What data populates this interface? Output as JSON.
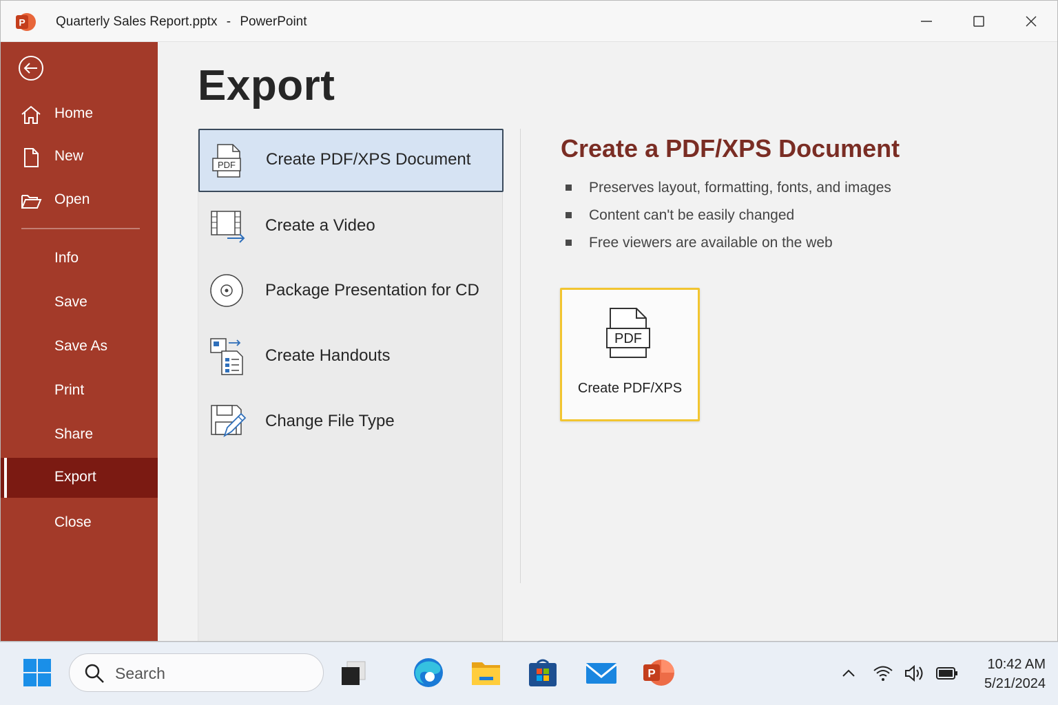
{
  "window": {
    "file_name": "Quarterly Sales Report.pptx",
    "separator": "-",
    "app_name": "PowerPoint",
    "app_logo_letter": "P"
  },
  "sidebar": {
    "back_icon": "arrow-left-circle-icon",
    "items": [
      {
        "label": "Home",
        "icon": "home-icon"
      },
      {
        "label": "New",
        "icon": "new-document-icon"
      },
      {
        "label": "Open",
        "icon": "folder-open-icon"
      },
      {
        "label": "Info"
      },
      {
        "label": "Save"
      },
      {
        "label": "Save As"
      },
      {
        "label": "Print"
      },
      {
        "label": "Share"
      },
      {
        "label": "Export",
        "active": true
      },
      {
        "label": "Close"
      }
    ],
    "colors": {
      "background": "#a33a29",
      "active": "#7b1a12"
    }
  },
  "main": {
    "title": "Export",
    "options": [
      {
        "label": "Create PDF/XPS Document",
        "icon": "pdf-document-icon",
        "selected": true,
        "icon_text": "PDF"
      },
      {
        "label": "Create a Video",
        "icon": "video-export-icon"
      },
      {
        "label": "Package Presentation for CD",
        "icon": "cd-disc-icon"
      },
      {
        "label": "Create Handouts",
        "icon": "handouts-icon"
      },
      {
        "label": "Change File Type",
        "icon": "change-file-type-icon"
      }
    ],
    "detail": {
      "title": "Create a PDF/XPS Document",
      "bullets": [
        "Preserves layout, formatting, fonts, and images",
        "Content can't be easily changed",
        "Free viewers are available on the web"
      ],
      "button_label": "Create PDF/XPS",
      "button_icon_text": "PDF",
      "accent_color": "#7a2d24",
      "button_border_color": "#f2c530"
    }
  },
  "taskbar": {
    "search_placeholder": "Search",
    "apps": [
      "task-view-icon",
      "edge-browser-icon",
      "file-explorer-icon",
      "microsoft-store-icon",
      "mail-icon",
      "powerpoint-icon"
    ],
    "tray": [
      "chevron-up-icon",
      "wifi-icon",
      "volume-icon",
      "battery-icon"
    ],
    "time": "10:42 AM",
    "date": "5/21/2024"
  }
}
